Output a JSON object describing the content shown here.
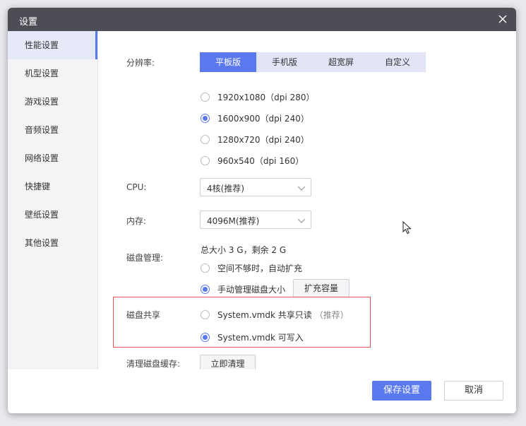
{
  "window": {
    "title": "设置"
  },
  "sidebar": {
    "items": [
      {
        "label": "性能设置",
        "active": true
      },
      {
        "label": "机型设置"
      },
      {
        "label": "游戏设置"
      },
      {
        "label": "音频设置"
      },
      {
        "label": "网络设置"
      },
      {
        "label": "快捷键"
      },
      {
        "label": "壁纸设置"
      },
      {
        "label": "其他设置"
      }
    ]
  },
  "performance": {
    "resolution": {
      "label": "分辨率:",
      "tabs": [
        {
          "label": "平板版",
          "active": true
        },
        {
          "label": "手机版"
        },
        {
          "label": "超宽屏"
        },
        {
          "label": "自定义"
        }
      ],
      "options": [
        {
          "label": "1920x1080（dpi 280）",
          "selected": false
        },
        {
          "label": "1600x900（dpi 240）",
          "selected": true
        },
        {
          "label": "1280x720（dpi 240）",
          "selected": false
        },
        {
          "label": "960x540（dpi 160）",
          "selected": false
        }
      ]
    },
    "cpu": {
      "label": "CPU:",
      "value": "4核(推荐)"
    },
    "memory": {
      "label": "内存:",
      "value": "4096M(推荐)"
    },
    "disk": {
      "label": "磁盘管理:",
      "summary": "总大小 3 G，剩余 2 G",
      "options": [
        {
          "label": "空间不够时，自动扩充",
          "selected": false
        },
        {
          "label": "手动管理磁盘大小",
          "selected": true
        }
      ],
      "expand_button": "扩充容量"
    },
    "disk_share": {
      "label": "磁盘共享",
      "options": [
        {
          "label": "System.vmdk 共享只读",
          "note": "（推荐）",
          "selected": false
        },
        {
          "label": "System.vmdk 可写入",
          "selected": true
        }
      ]
    },
    "cache": {
      "label": "清理磁盘缓存:",
      "button": "立即清理"
    }
  },
  "footer": {
    "save_label": "保存设置",
    "cancel_label": "取消"
  },
  "colors": {
    "accent": "#5b79ef",
    "titlebar": "#4d4e55",
    "highlight_border": "#e05252"
  }
}
